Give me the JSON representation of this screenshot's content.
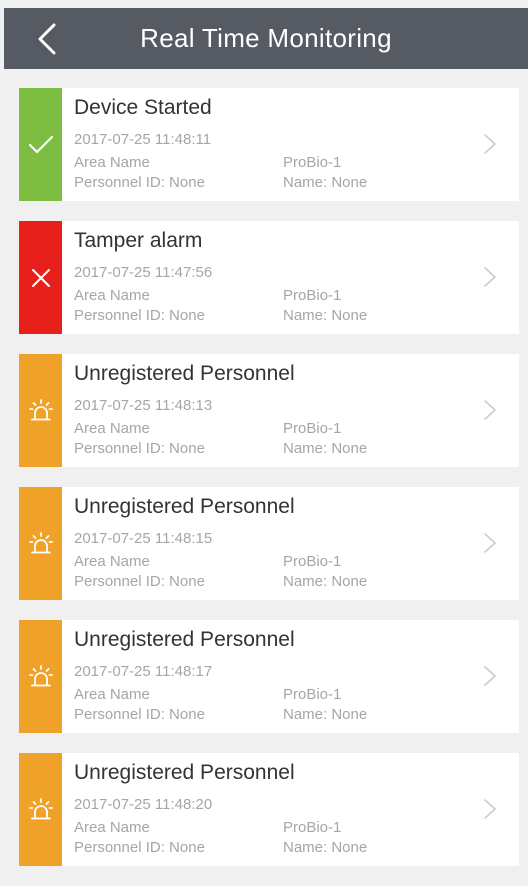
{
  "header": {
    "title": "Real Time Monitoring",
    "back_icon": "chevron-left-icon"
  },
  "colors": {
    "header_bg": "#565a63",
    "success": "#7dbd42",
    "alarm": "#e8201c",
    "warning": "#f0a127",
    "background": "#f0f0f0"
  },
  "events": [
    {
      "status": "success",
      "icon": "check-icon",
      "title": "Device Started",
      "time": "2017-07-25 11:48:11",
      "area_label": "Area Name",
      "area_value": "ProBio-1",
      "personnel": "Personnel ID: None",
      "name": "Name: None"
    },
    {
      "status": "alarm",
      "icon": "close-icon",
      "title": "Tamper alarm",
      "time": "2017-07-25 11:47:56",
      "area_label": "Area Name",
      "area_value": "ProBio-1",
      "personnel": "Personnel ID: None",
      "name": "Name: None"
    },
    {
      "status": "warning",
      "icon": "alarm-light-icon",
      "title": "Unregistered Personnel",
      "time": "2017-07-25 11:48:13",
      "area_label": "Area Name",
      "area_value": "ProBio-1",
      "personnel": "Personnel ID: None",
      "name": "Name: None"
    },
    {
      "status": "warning",
      "icon": "alarm-light-icon",
      "title": "Unregistered Personnel",
      "time": "2017-07-25 11:48:15",
      "area_label": "Area Name",
      "area_value": "ProBio-1",
      "personnel": "Personnel ID: None",
      "name": "Name: None"
    },
    {
      "status": "warning",
      "icon": "alarm-light-icon",
      "title": "Unregistered Personnel",
      "time": "2017-07-25 11:48:17",
      "area_label": "Area Name",
      "area_value": "ProBio-1",
      "personnel": "Personnel ID: None",
      "name": "Name: None"
    },
    {
      "status": "warning",
      "icon": "alarm-light-icon",
      "title": "Unregistered Personnel",
      "time": "2017-07-25 11:48:20",
      "area_label": "Area Name",
      "area_value": "ProBio-1",
      "personnel": "Personnel ID: None",
      "name": "Name: None"
    }
  ]
}
